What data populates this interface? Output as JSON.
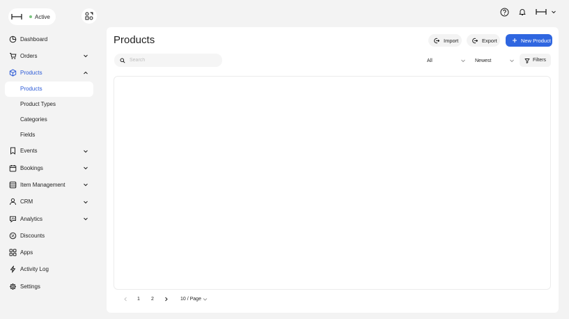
{
  "brand": {
    "status": "Active",
    "status_color": "#7bc47f"
  },
  "sidebar": {
    "items": [
      {
        "label": "Dashboard",
        "icon": "dashboard-icon",
        "chevron": false
      },
      {
        "label": "Orders",
        "icon": "cart-icon",
        "chevron": true
      },
      {
        "label": "Products",
        "icon": "box-icon",
        "chevron": true,
        "expanded": true,
        "subitems": [
          {
            "label": "Products",
            "selected": true
          },
          {
            "label": "Product Types"
          },
          {
            "label": "Categories"
          },
          {
            "label": "Fields"
          }
        ]
      },
      {
        "label": "Events",
        "icon": "bookmark-icon",
        "chevron": true
      },
      {
        "label": "Bookings",
        "icon": "calendar-icon",
        "chevron": true
      },
      {
        "label": "Item Management",
        "icon": "database-icon",
        "chevron": true
      },
      {
        "label": "CRM",
        "icon": "user-icon",
        "chevron": true
      },
      {
        "label": "Analytics",
        "icon": "chart-icon",
        "chevron": true
      },
      {
        "label": "Discounts",
        "icon": "discount-icon",
        "chevron": false
      },
      {
        "label": "Apps",
        "icon": "apps-icon",
        "chevron": false
      },
      {
        "label": "Activity Log",
        "icon": "bolt-icon",
        "chevron": false
      },
      {
        "label": "Settings",
        "icon": "gear-icon",
        "chevron": false
      }
    ]
  },
  "topbar": {
    "icons": [
      "help-icon",
      "bell-icon",
      "avatar-logo",
      "chevron-down-icon"
    ]
  },
  "main": {
    "title": "Products",
    "import_label": "Import",
    "export_label": "Export",
    "new_label": "New Product",
    "search_placeholder": "Search",
    "status_filter": "All",
    "sort": "Newest",
    "filters_label": "Filters",
    "pagination": {
      "pages": [
        "1",
        "2"
      ],
      "page_size": "10 / Page"
    }
  },
  "colors": {
    "accent": "#2d5bd7",
    "primary_button": "#2f66e0",
    "background": "#f3f3f3"
  }
}
